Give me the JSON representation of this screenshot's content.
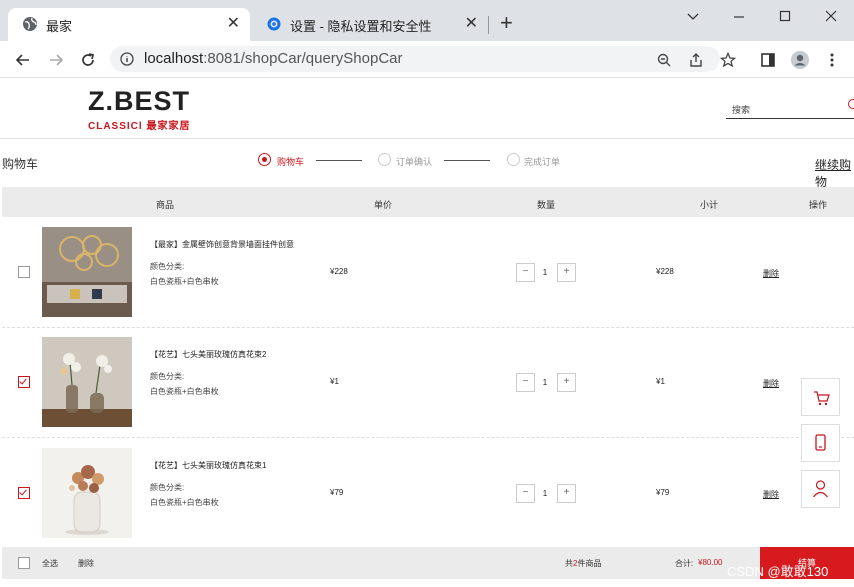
{
  "browser": {
    "tabs": [
      {
        "title": "最家",
        "active": true
      },
      {
        "title": "设置 - 隐私设置和安全性",
        "active": false
      }
    ],
    "new_tab": "+",
    "close_glyph": "✕",
    "url_host": "localhost",
    "url_rest": ":8081/shopCar/queryShopCar"
  },
  "header": {
    "logo_main": "Z.BEST",
    "logo_sub": "CLASSICl 最家家居",
    "search_placeholder": "搜索"
  },
  "page": {
    "breadcrumb": "购物车",
    "steps": [
      {
        "label": "购物车",
        "active": true
      },
      {
        "label": "订单确认",
        "active": false
      },
      {
        "label": "完成订单",
        "active": false
      }
    ],
    "continue_shopping": "继续购物"
  },
  "table": {
    "headers": [
      "商品",
      "单价",
      "数量",
      "小计",
      "操作"
    ],
    "rows": [
      {
        "checked": false,
        "name": "【最家】金属壁饰创意背景墙面挂件创意",
        "attr_label": "颜色分类:",
        "attr_value": "白色瓷瓶+白色串枚",
        "price": "¥228",
        "qty": "1",
        "subtotal": "¥228",
        "action": "删除"
      },
      {
        "checked": true,
        "name": "【花艺】七头美丽玫瑰仿真花束2",
        "attr_label": "颜色分类:",
        "attr_value": "白色瓷瓶+白色串枚",
        "price": "¥1",
        "qty": "1",
        "subtotal": "¥1",
        "action": "删除"
      },
      {
        "checked": true,
        "name": "【花艺】七头美丽玫瑰仿真花束1",
        "attr_label": "颜色分类:",
        "attr_value": "白色瓷瓶+白色串枚",
        "price": "¥79",
        "qty": "1",
        "subtotal": "¥79",
        "action": "删除"
      }
    ],
    "minus": "−",
    "plus": "+"
  },
  "footer": {
    "select_all": "全选",
    "delete": "删除",
    "count_prefix": "共",
    "count": "2",
    "count_suffix": "件商品",
    "total_label": "合计:",
    "total_value": "¥80.00",
    "checkout": "结算"
  },
  "float_icons": [
    "cart-icon",
    "phone-icon",
    "user-icon"
  ],
  "watermark": "CSDN @敢敢130",
  "colors": {
    "accent": "#c8161d",
    "checkout": "#d71a1e"
  }
}
